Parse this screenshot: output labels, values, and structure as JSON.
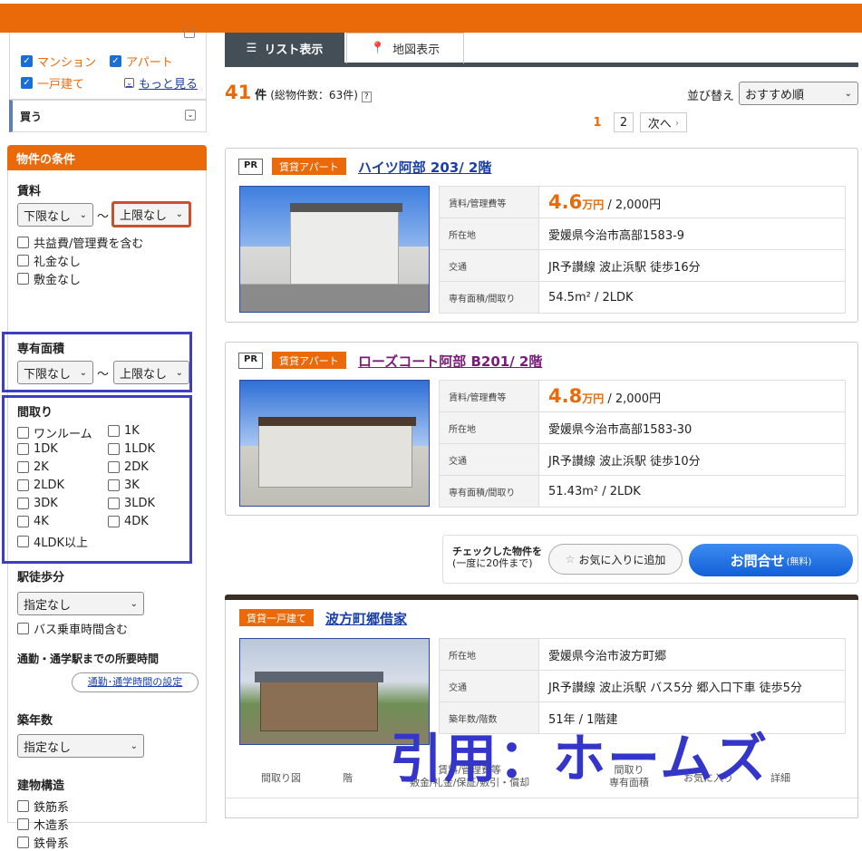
{
  "sidebar": {
    "type_items": [
      {
        "label": "マンション",
        "checked": true
      },
      {
        "label": "アパート",
        "checked": true
      },
      {
        "label": "一戸建て",
        "checked": true
      }
    ],
    "more_link": "もっと見る",
    "buy_label": "買う",
    "conditions_title": "物件の条件",
    "rent": {
      "title": "賃料",
      "min": "下限なし",
      "max": "上限なし",
      "tilde": "～",
      "options": [
        "共益費/管理費を含む",
        "礼金なし",
        "敷金なし"
      ]
    },
    "area": {
      "title": "専有面積",
      "min": "下限なし",
      "max": "上限なし",
      "tilde": "～"
    },
    "layout": {
      "title": "間取り",
      "items": [
        "ワンルーム",
        "1K",
        "1DK",
        "1LDK",
        "2K",
        "2DK",
        "2LDK",
        "3K",
        "3DK",
        "3LDK",
        "4K",
        "4DK",
        "4LDK以上"
      ]
    },
    "walk": {
      "title": "駅徒歩分",
      "value": "指定なし",
      "bus": "バス乗車時間含む"
    },
    "commute": {
      "title": "通勤・通学駅までの所要時間",
      "button": "通勤･通学時間の設定"
    },
    "age": {
      "title": "築年数",
      "value": "指定なし"
    },
    "structure": {
      "title": "建物構造",
      "items": [
        "鉄筋系",
        "木造系",
        "鉄骨系"
      ]
    }
  },
  "tabs": {
    "list": "リスト表示",
    "map": "地図表示"
  },
  "results": {
    "count": "41",
    "count_unit": "件",
    "total": "(総物件数：63件)",
    "help": "?",
    "sort_label": "並び替え",
    "sort_value": "おすすめ順"
  },
  "pagination": {
    "pages": [
      "1",
      "2"
    ],
    "next": "次へ"
  },
  "listings": [
    {
      "pr": "PR",
      "tag": "賃貸アパート",
      "title": "ハイツ阿部 203/ 2階",
      "rows": [
        {
          "k": "賃料/管理費等",
          "price": "4.6",
          "price_unit": "万円",
          "fee": " / 2,000円"
        },
        {
          "k": "所在地",
          "v": "愛媛県今治市高部1583-9"
        },
        {
          "k": "交通",
          "v": "JR予讃線 波止浜駅 徒歩16分"
        },
        {
          "k": "専有面積/間取り",
          "v": "54.5m² / 2LDK"
        }
      ]
    },
    {
      "pr": "PR",
      "tag": "賃貸アパート",
      "title": "ローズコート阿部 B201/ 2階",
      "rows": [
        {
          "k": "賃料/管理費等",
          "price": "4.8",
          "price_unit": "万円",
          "fee": " / 2,000円"
        },
        {
          "k": "所在地",
          "v": "愛媛県今治市高部1583-30"
        },
        {
          "k": "交通",
          "v": "JR予讃線 波止浜駅 徒歩10分"
        },
        {
          "k": "専有面積/間取り",
          "v": "51.43m² / 2LDK"
        }
      ]
    },
    {
      "tag": "賃貸一戸建て",
      "title": "波方町郷借家",
      "rows": [
        {
          "k": "所在地",
          "v": "愛媛県今治市波方町郷"
        },
        {
          "k": "交通",
          "v": "JR予讃線 波止浜駅 バス5分 郷入口下車 徒歩5分"
        },
        {
          "k": "築年数/階数",
          "v": "51年 / 1階建"
        }
      ]
    }
  ],
  "action": {
    "checked_label": "チェックした物件を",
    "checked_sub": "(一度に20件まで)",
    "fav": "お気に入りに追加",
    "inquiry": "お問合せ",
    "inquiry_sub": "(無料)"
  },
  "table_header": {
    "plan": "間取り図",
    "floor": "階",
    "rent": "賃料/管理費等",
    "deposit": "敷金/礼金/保証/敷引・償却",
    "layout": "間取り",
    "area": "専有面積",
    "fav": "お気に入り",
    "detail": "詳細"
  },
  "watermark": "引用：ホームズ",
  "colors": {
    "accent": "#ea6a0a",
    "highlight": "#3c3fbf",
    "link": "#1a3fa8"
  }
}
